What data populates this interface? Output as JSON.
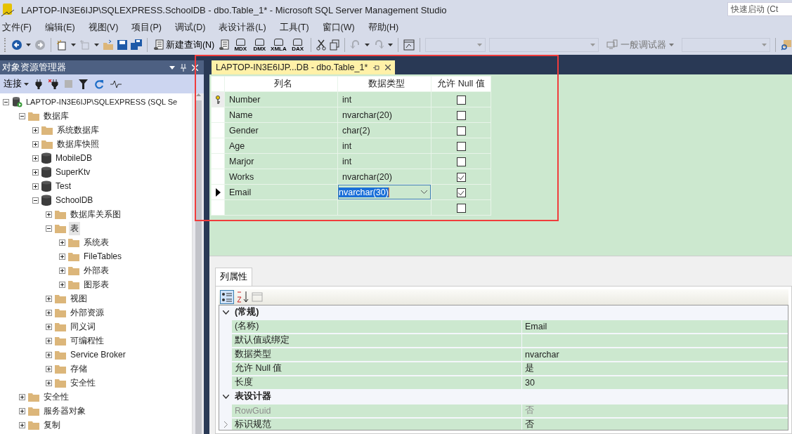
{
  "window": {
    "title": "LAPTOP-IN3E6IJP\\SQLEXPRESS.SchoolDB - dbo.Table_1* - Microsoft SQL Server Management Studio"
  },
  "quick_launch": {
    "placeholder": "快速启动 (Ct"
  },
  "menu": [
    "文件(F)",
    "编辑(E)",
    "视图(V)",
    "项目(P)",
    "调试(D)",
    "表设计器(L)",
    "工具(T)",
    "窗口(W)",
    "帮助(H)"
  ],
  "toolbar": {
    "new_query": "新建查询(N)",
    "query_types": [
      "MDX",
      "DMX",
      "XMLA",
      "DAX"
    ],
    "debugger": "一般调试器"
  },
  "object_explorer": {
    "title": "对象资源管理器",
    "connect": "连接",
    "tree": [
      {
        "label": "LAPTOP-IN3E6IJP\\SQLEXPRESS (SQL Se",
        "kind": "server",
        "expanded": true,
        "selected": false,
        "children": [
          {
            "label": "数据库",
            "kind": "folder",
            "expanded": true,
            "selected": false,
            "children": [
              {
                "label": "系统数据库",
                "kind": "folder",
                "expanded": false,
                "selected": false
              },
              {
                "label": "数据库快照",
                "kind": "folder",
                "expanded": false,
                "selected": false
              },
              {
                "label": "MobileDB",
                "kind": "database",
                "expanded": false,
                "selected": false
              },
              {
                "label": "SuperKtv",
                "kind": "database",
                "expanded": false,
                "selected": false
              },
              {
                "label": "Test",
                "kind": "database",
                "expanded": false,
                "selected": false
              },
              {
                "label": "SchoolDB",
                "kind": "database",
                "expanded": true,
                "selected": false,
                "children": [
                  {
                    "label": "数据库关系图",
                    "kind": "folder",
                    "expanded": false,
                    "selected": false
                  },
                  {
                    "label": "表",
                    "kind": "folder",
                    "expanded": true,
                    "selected": true,
                    "children": [
                      {
                        "label": "系统表",
                        "kind": "folder",
                        "expanded": false,
                        "selected": false
                      },
                      {
                        "label": "FileTables",
                        "kind": "folder",
                        "expanded": false,
                        "selected": false
                      },
                      {
                        "label": "外部表",
                        "kind": "folder",
                        "expanded": false,
                        "selected": false
                      },
                      {
                        "label": "图形表",
                        "kind": "folder",
                        "expanded": false,
                        "selected": false
                      }
                    ]
                  },
                  {
                    "label": "视图",
                    "kind": "folder",
                    "expanded": false,
                    "selected": false
                  },
                  {
                    "label": "外部资源",
                    "kind": "folder",
                    "expanded": false,
                    "selected": false
                  },
                  {
                    "label": "同义词",
                    "kind": "folder",
                    "expanded": false,
                    "selected": false
                  },
                  {
                    "label": "可编程性",
                    "kind": "folder",
                    "expanded": false,
                    "selected": false
                  },
                  {
                    "label": "Service Broker",
                    "kind": "folder",
                    "expanded": false,
                    "selected": false
                  },
                  {
                    "label": "存储",
                    "kind": "folder",
                    "expanded": false,
                    "selected": false
                  },
                  {
                    "label": "安全性",
                    "kind": "folder",
                    "expanded": false,
                    "selected": false
                  }
                ]
              }
            ]
          },
          {
            "label": "安全性",
            "kind": "folder",
            "expanded": false,
            "selected": false
          },
          {
            "label": "服务器对象",
            "kind": "folder",
            "expanded": false,
            "selected": false
          },
          {
            "label": "复制",
            "kind": "folder",
            "expanded": false,
            "selected": false
          }
        ]
      }
    ]
  },
  "document_tab": {
    "label": "LAPTOP-IN3E6IJP...DB - dbo.Table_1*",
    "selected": true
  },
  "designer": {
    "columns": [
      "列名",
      "数据类型",
      "允许 Null 值"
    ],
    "rows": [
      {
        "name": "Number",
        "type": "int",
        "allow_null": false,
        "primary_key": true,
        "current": false,
        "editing": false
      },
      {
        "name": "Name",
        "type": "nvarchar(20)",
        "allow_null": false,
        "primary_key": false,
        "current": false,
        "editing": false
      },
      {
        "name": "Gender",
        "type": "char(2)",
        "allow_null": false,
        "primary_key": false,
        "current": false,
        "editing": false
      },
      {
        "name": "Age",
        "type": "int",
        "allow_null": false,
        "primary_key": false,
        "current": false,
        "editing": false
      },
      {
        "name": "Marjor",
        "type": "int",
        "allow_null": false,
        "primary_key": false,
        "current": false,
        "editing": false
      },
      {
        "name": "Works",
        "type": "nvarchar(20)",
        "allow_null": true,
        "primary_key": false,
        "current": false,
        "editing": false
      },
      {
        "name": "Email",
        "type": "nvarchar(30)",
        "allow_null": true,
        "primary_key": false,
        "current": true,
        "editing": true
      }
    ],
    "new_row": {
      "allow_null": false
    }
  },
  "properties": {
    "tab": "列属性",
    "categories": [
      {
        "name": "(常规)",
        "expanded": true,
        "rows": [
          {
            "name": "(名称)",
            "value": "Email",
            "disabled": false,
            "expandable": false
          },
          {
            "name": "默认值或绑定",
            "disabled": false,
            "expandable": false
          },
          {
            "name": "数据类型",
            "value": "nvarchar",
            "disabled": false,
            "expandable": false
          },
          {
            "name": "允许 Null 值",
            "value": "是",
            "disabled": false,
            "expandable": false
          },
          {
            "name": "长度",
            "value": "30",
            "disabled": false,
            "expandable": false
          }
        ]
      },
      {
        "name": "表设计器",
        "expanded": true,
        "rows": [
          {
            "name": "RowGuid",
            "value": "否",
            "disabled": true,
            "expandable": false
          },
          {
            "name": "标识规范",
            "value": "否",
            "disabled": false,
            "expandable": true
          }
        ]
      }
    ]
  }
}
